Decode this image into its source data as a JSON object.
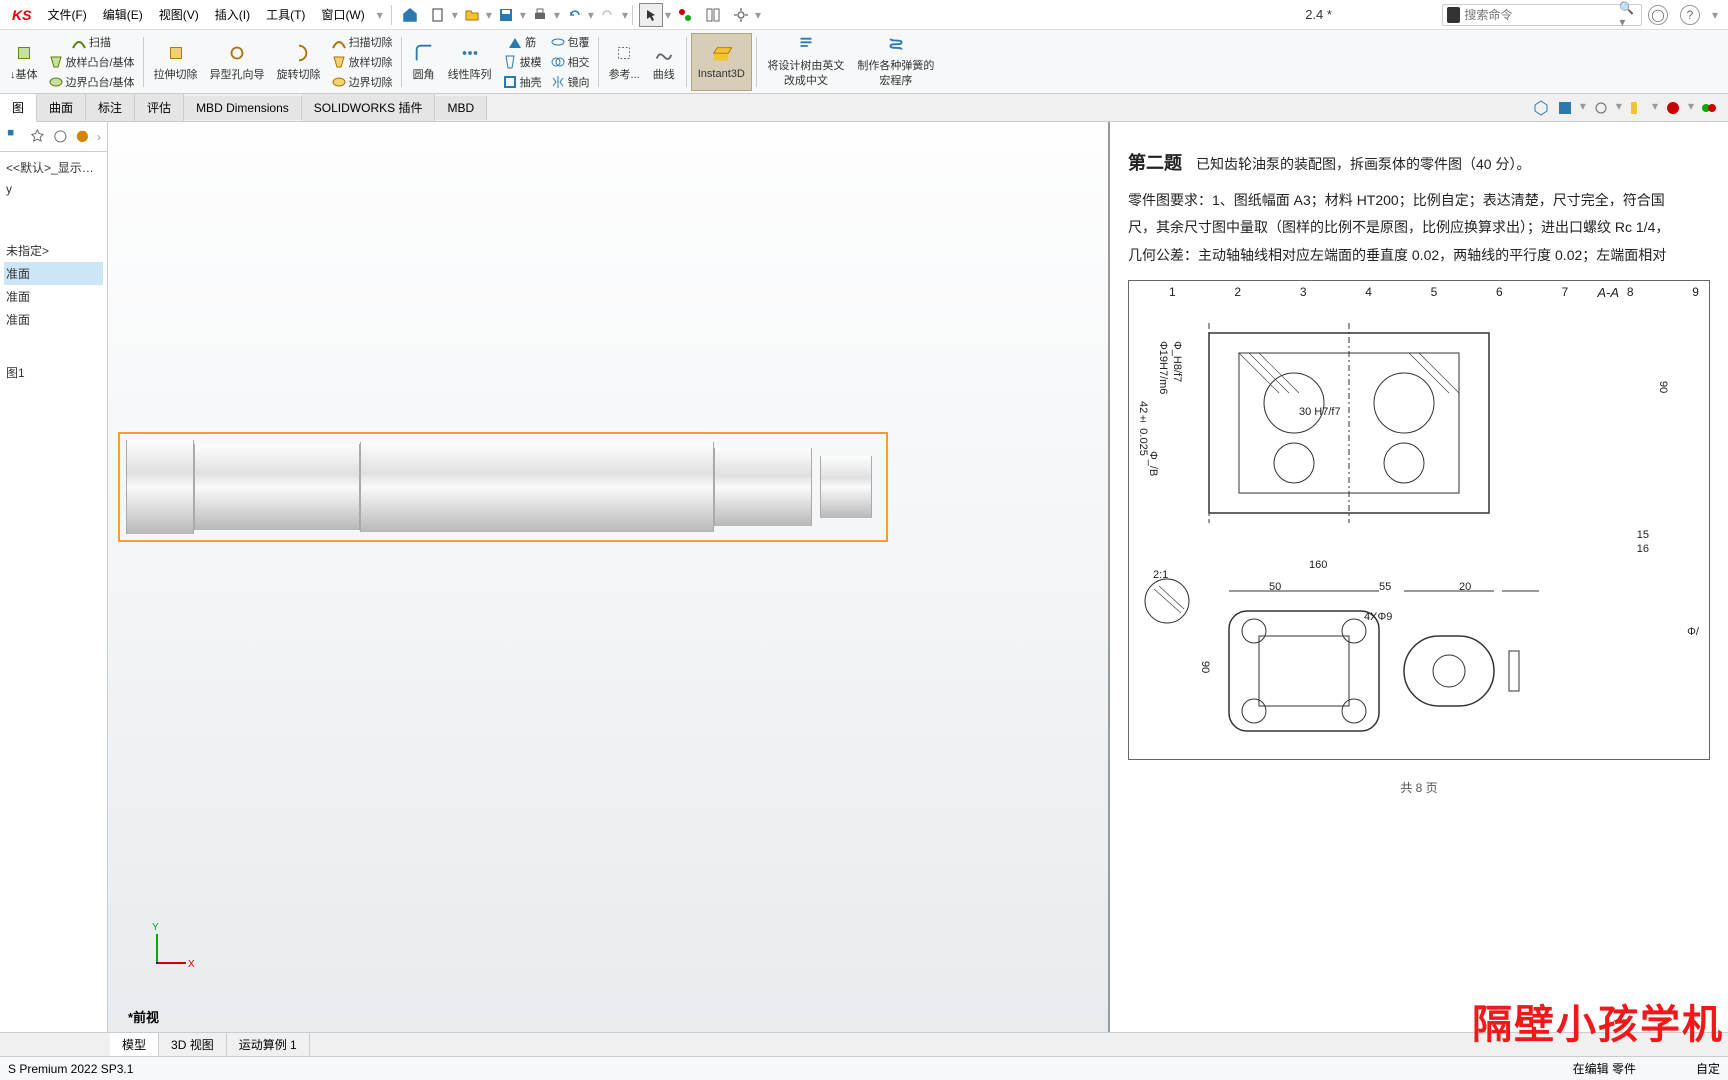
{
  "menubar": {
    "logo": "KS",
    "items": [
      {
        "label": "文件(F)"
      },
      {
        "label": "编辑(E)"
      },
      {
        "label": "视图(V)"
      },
      {
        "label": "插入(I)"
      },
      {
        "label": "工具(T)"
      },
      {
        "label": "窗口(W)"
      }
    ],
    "doc_title": "2.4 *",
    "search_placeholder": "搜索命令"
  },
  "ribbon": {
    "groups": [
      {
        "items": [
          {
            "label": "↓基体",
            "icon": "extrude"
          },
          {
            "label": "扫描",
            "icon": "sweep"
          },
          {
            "label": "放样凸台/基体",
            "icon": "loft"
          },
          {
            "label": "边界凸台/基体",
            "icon": "boundary"
          }
        ]
      },
      {
        "items": [
          {
            "label": "拉伸切除",
            "icon": "cut-extrude"
          },
          {
            "label": "异型孔向导",
            "icon": "hole-wizard"
          },
          {
            "label": "旋转切除",
            "icon": "cut-revolve"
          },
          {
            "label": "扫描切除",
            "icon": "cut-sweep"
          },
          {
            "label": "放样切除",
            "icon": "cut-loft"
          },
          {
            "label": "边界切除",
            "icon": "cut-boundary"
          }
        ]
      },
      {
        "items": [
          {
            "label": "圆角",
            "icon": "fillet"
          },
          {
            "label": "线性阵列",
            "icon": "linear-pattern"
          },
          {
            "label": "筋",
            "icon": "rib"
          },
          {
            "label": "拔模",
            "icon": "draft"
          },
          {
            "label": "抽壳",
            "icon": "shell"
          },
          {
            "label": "包覆",
            "icon": "wrap"
          },
          {
            "label": "相交",
            "icon": "intersect"
          },
          {
            "label": "镜向",
            "icon": "mirror"
          }
        ]
      },
      {
        "items": [
          {
            "label": "参考...",
            "icon": "ref-geom"
          },
          {
            "label": "曲线",
            "icon": "curves"
          }
        ]
      },
      {
        "items": [
          {
            "label": "Instant3D",
            "icon": "instant3d",
            "active": true
          }
        ]
      },
      {
        "items": [
          {
            "label": "将设计树由英文改成中文",
            "icon": "translate"
          },
          {
            "label": "制作各种弹簧的宏程序",
            "icon": "macro"
          }
        ]
      }
    ]
  },
  "tabs": [
    "图",
    "曲面",
    "标注",
    "评估",
    "MBD Dimensions",
    "SOLIDWORKS 插件",
    "MBD"
  ],
  "side_tree": {
    "config": "<<默认>_显示状态",
    "nodes": [
      "y",
      "",
      "未指定>",
      "准面",
      "准面",
      "准面",
      "",
      "图1"
    ]
  },
  "view_label": "*前视",
  "doc": {
    "q_title": "第二题",
    "q_desc": "已知齿轮油泵的装配图，拆画泵体的零件图（40 分）。",
    "req1": "零件图要求：1、图纸幅面 A3；材料 HT200；比例自定；表达清楚，尺寸完全，符合国",
    "req2": "尺，其余尺寸图中量取（图样的比例不是原图，比例应换算求出）；进出口螺纹 Rc 1/4，",
    "req3": "几何公差：主动轴轴线相对应左端面的垂直度 0.02，两轴线的平行度 0.02；左端面相对",
    "callout_numbers": [
      "1",
      "2",
      "3",
      "4",
      "5",
      "6",
      "7",
      "8",
      "9"
    ],
    "section_label": "A-A",
    "dims": {
      "phi19": "Φ19H7/m6",
      "phi_f7": "Φ_H8/f7",
      "fit30": "30 H7/f7",
      "len42": "42± 0.025",
      "phi_b": "Φ_/B",
      "bottom15": "15",
      "bottom16": "16",
      "w160": "160",
      "ratio": "2:1",
      "w50": "50",
      "w55": "55",
      "w20": "20",
      "holes": "4XΦ9",
      "h90": "90",
      "phi_a": "Φ/"
    },
    "page_foot": "共 8 页"
  },
  "bottom_tabs": [
    "模型",
    "3D 视图",
    "运动算例 1"
  ],
  "status": {
    "left": "S Premium 2022 SP3.1",
    "right": "在编辑 零件",
    "right2": "自定"
  },
  "watermark": "隔壁小孩学机"
}
